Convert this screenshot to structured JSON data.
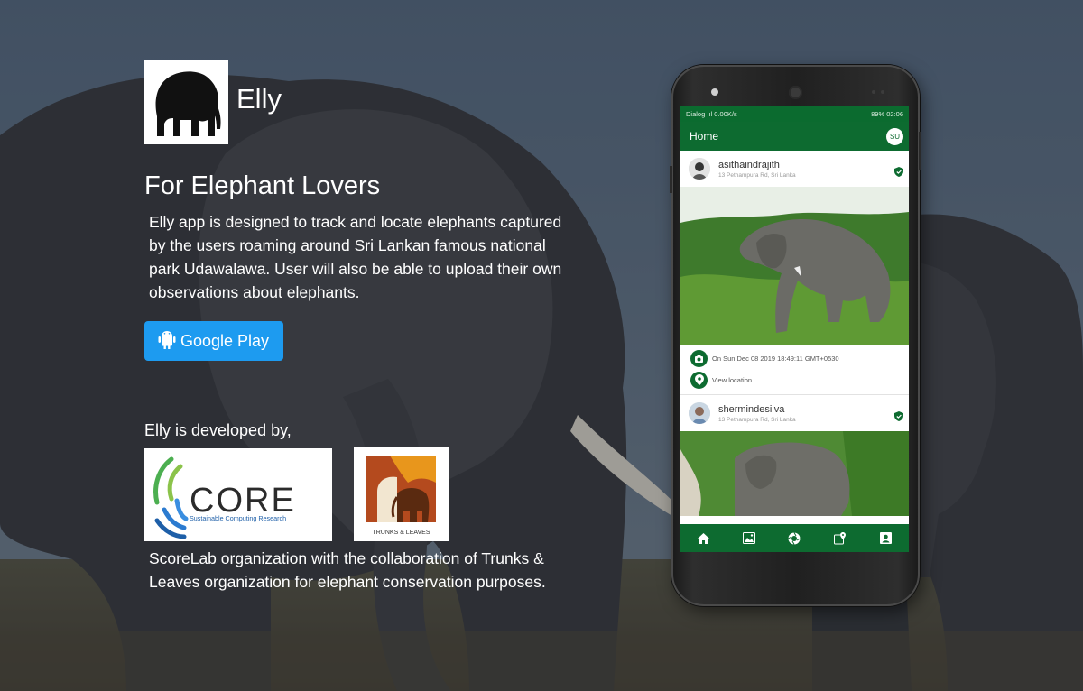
{
  "app": {
    "name": "Elly",
    "tagline": "For Elephant Lovers",
    "description": "Elly app is designed to track and locate elephants captured by the users roaming around Sri Lankan famous national park Udawalawa. User will also be able to upload their own observations about elephants."
  },
  "download": {
    "label": "Google Play",
    "icon": "android-icon"
  },
  "developers": {
    "intro": "Elly is developed by,",
    "core_logo": {
      "name": "CORE",
      "sub": "Sustainable Computing Research"
    },
    "tl_logo": {
      "label": "TRUNKS & LEAVES"
    },
    "description": "ScoreLab organization with the collaboration of Trunks & Leaves organization for elephant conservation purposes."
  },
  "phone": {
    "status_left": "Dialog .ıl 0.00K/s",
    "status_right": "89% 02:06",
    "appbar_title": "Home",
    "avatar_initials": "SU",
    "posts": [
      {
        "username": "asithaindrajith",
        "location": "13 Pethampura Rd, Sri Lanka",
        "date": "On Sun Dec 08 2019 18:49:11 GMT+0530",
        "view_location": "View location"
      },
      {
        "username": "shermindesilva",
        "location": "13 Pethampura Rd, Sri Lanka"
      }
    ],
    "nav": [
      "home-icon",
      "gallery-icon",
      "camera-icon",
      "map-icon",
      "profile-icon"
    ]
  },
  "colors": {
    "brand_green": "#0d6b30",
    "button_blue": "#1d9bf0",
    "sky": "#5b7088"
  }
}
